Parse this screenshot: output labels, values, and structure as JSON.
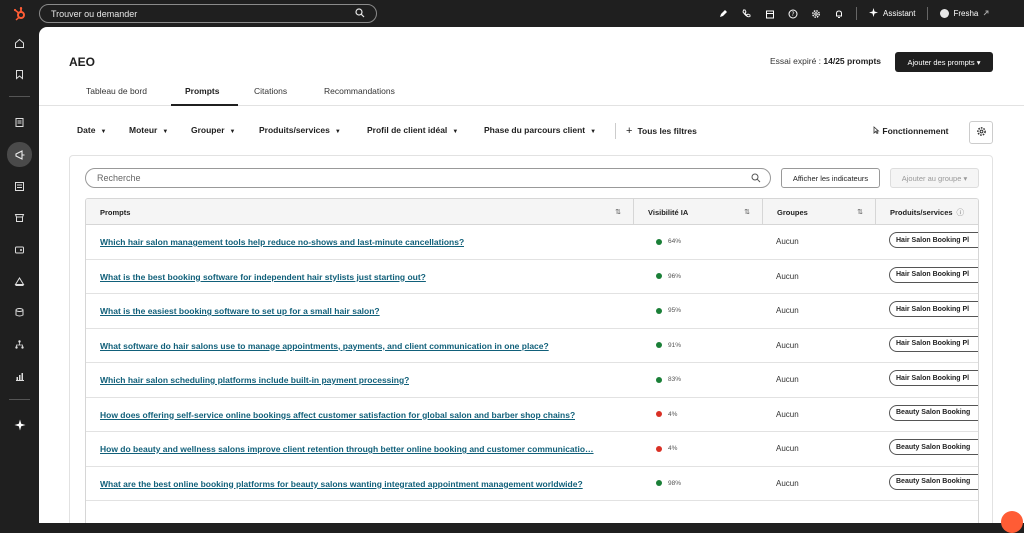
{
  "topbar": {
    "search_placeholder": "Trouver ou demander",
    "assistant_label": "Assistant",
    "account_name": "Fresha",
    "icons": [
      "hubspot-logo-icon",
      "search-icon",
      "edit-icon",
      "phone-icon",
      "marketplace-icon",
      "help-icon",
      "settings-icon",
      "bell-icon",
      "sparkle-icon",
      "external-icon"
    ]
  },
  "sidebar": {
    "icons": [
      "home-icon",
      "bookmark-icon",
      "contacts-icon",
      "marketing-icon",
      "content-icon",
      "commerce-icon",
      "service-icon",
      "automation-icon",
      "data-icon",
      "network-icon",
      "reporting-icon",
      "breeze-icon"
    ],
    "active_index": 3
  },
  "header": {
    "title": "AEO",
    "trial_prefix": "Essai expiré : ",
    "trial_count": "14/25 prompts",
    "add_button": "Ajouter des prompts ▾"
  },
  "tabs": [
    {
      "label": "Tableau de bord"
    },
    {
      "label": "Prompts"
    },
    {
      "label": "Citations"
    },
    {
      "label": "Recommandations"
    }
  ],
  "filters": [
    {
      "label": "Date"
    },
    {
      "label": "Moteur"
    },
    {
      "label": "Grouper"
    },
    {
      "label": "Produits/services"
    },
    {
      "label": "Profil de client idéal"
    },
    {
      "label": "Phase du parcours client"
    }
  ],
  "all_filters_label": "Tous les filtres",
  "fonctionnement_label": "Fonctionnement",
  "table_controls": {
    "search_placeholder": "Recherche",
    "indicators_button": "Afficher les indicateurs",
    "add_group_button": "Ajouter au groupe ▾"
  },
  "columns": {
    "prompts": "Prompts",
    "visibility": "Visibilité IA",
    "groups": "Groupes",
    "products": "Produits/services"
  },
  "colors": {
    "good": "#1a7f37",
    "bad": "#d93025",
    "link": "#11607a",
    "accent": "#ff5c35"
  },
  "rows": [
    {
      "prompt": "Which hair salon management tools help reduce no-shows and last-minute cancellations?",
      "visibility": "64%",
      "status": "good",
      "group": "Aucun",
      "product": "Hair Salon Booking Pl"
    },
    {
      "prompt": "What is the best booking software for independent hair stylists just starting out?",
      "visibility": "96%",
      "status": "good",
      "group": "Aucun",
      "product": "Hair Salon Booking Pl"
    },
    {
      "prompt": "What is the easiest booking software to set up for a small hair salon?",
      "visibility": "95%",
      "status": "good",
      "group": "Aucun",
      "product": "Hair Salon Booking Pl"
    },
    {
      "prompt": "What software do hair salons use to manage appointments, payments, and client communication in one place?",
      "visibility": "91%",
      "status": "good",
      "group": "Aucun",
      "product": "Hair Salon Booking Pl"
    },
    {
      "prompt": "Which hair salon scheduling platforms include built-in payment processing?",
      "visibility": "83%",
      "status": "good",
      "group": "Aucun",
      "product": "Hair Salon Booking Pl"
    },
    {
      "prompt": "How does offering self-service online bookings affect customer satisfaction for global salon and barber shop chains?",
      "visibility": "4%",
      "status": "bad",
      "group": "Aucun",
      "product": "Beauty Salon Booking"
    },
    {
      "prompt": "How do beauty and wellness salons improve client retention through better online booking and customer communicatio…",
      "visibility": "4%",
      "status": "bad",
      "group": "Aucun",
      "product": "Beauty Salon Booking"
    },
    {
      "prompt": "What are the best online booking platforms for beauty salons wanting integrated appointment management worldwide?",
      "visibility": "98%",
      "status": "good",
      "group": "Aucun",
      "product": "Beauty Salon Booking"
    }
  ]
}
